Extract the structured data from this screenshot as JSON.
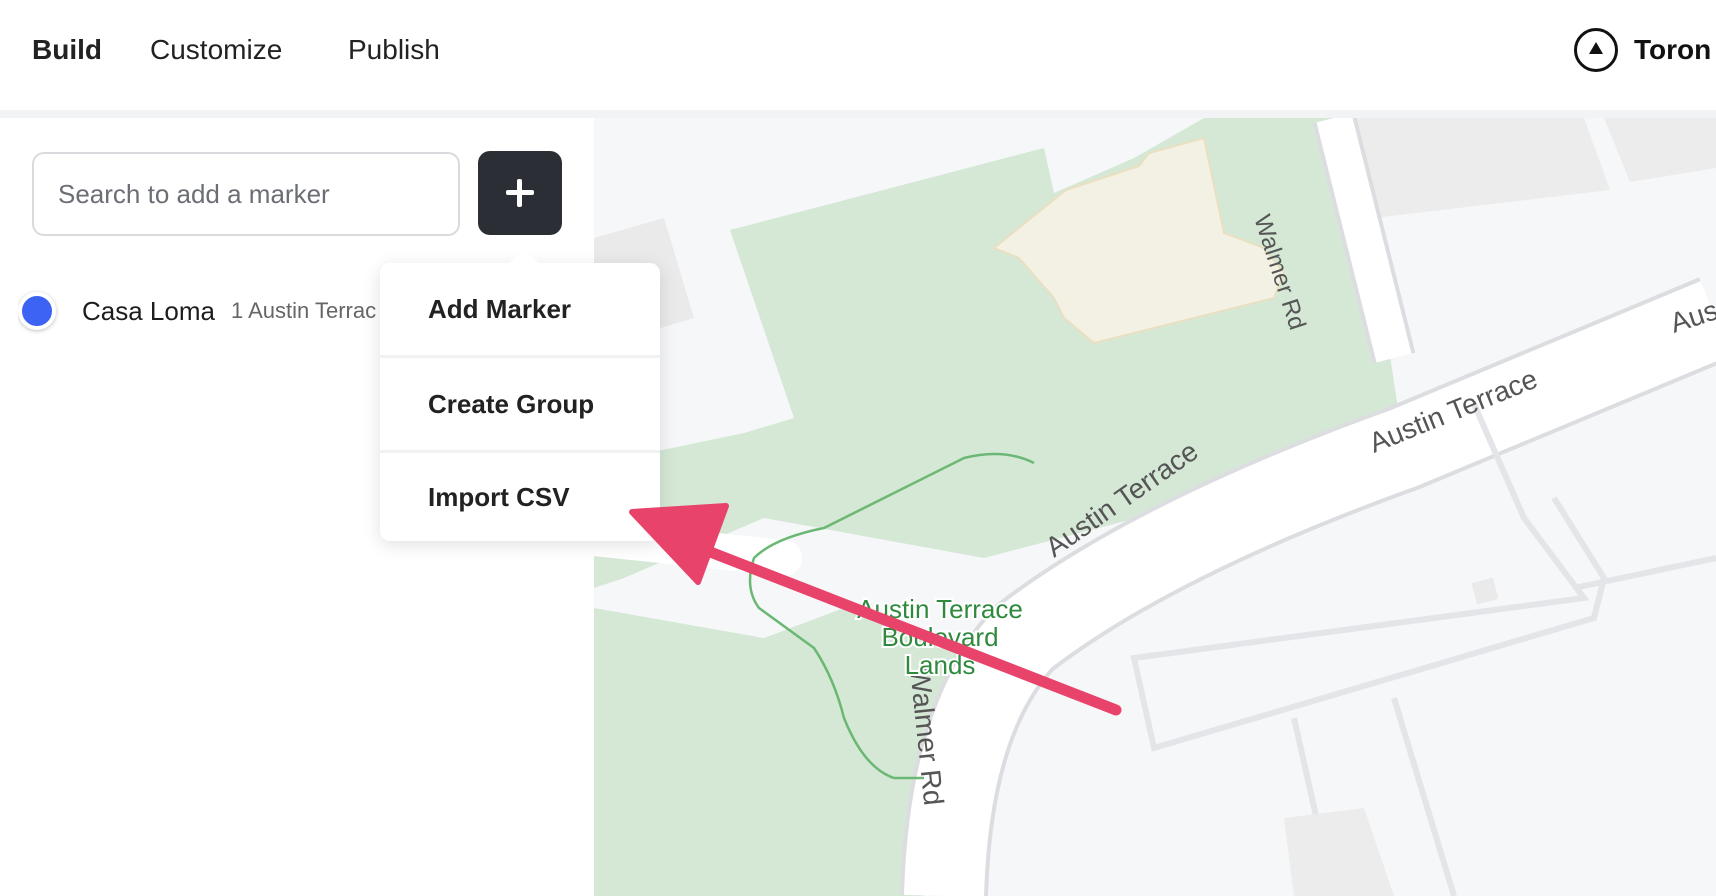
{
  "nav": {
    "tabs": [
      {
        "label": "Build",
        "active": true
      },
      {
        "label": "Customize",
        "active": false
      },
      {
        "label": "Publish",
        "active": false
      }
    ],
    "brand_name": "Toron"
  },
  "sidebar": {
    "search": {
      "placeholder": "Search to add a marker",
      "value": ""
    },
    "add_button_icon": "plus-icon",
    "markers": [
      {
        "name": "Casa Loma",
        "address": "1 Austin Terrac",
        "color": "#3d63f5"
      }
    ]
  },
  "dropdown": {
    "items": [
      {
        "label": "Add Marker"
      },
      {
        "label": "Create Group"
      },
      {
        "label": "Import CSV"
      }
    ]
  },
  "map": {
    "labels": {
      "walmer_rd_top": "Walmer Rd",
      "walmer_rd_bottom": "Walmer Rd",
      "austin_terrace_1": "Austin Terrace",
      "austin_terrace_2": "Austin Terrace",
      "austin_terrace_3": "Aus",
      "park_line1": "Austin Terrace",
      "park_line2": "Boulevard",
      "park_line3": "Lands"
    },
    "colors": {
      "park": "#d5e8d6",
      "road": "#ffffff",
      "ground": "#f6f7f9",
      "building": "#eaeaea",
      "castle": "#f3f1e3",
      "path": "#6bb874",
      "park_text": "#2f8a3e"
    }
  },
  "annotation": {
    "color": "#e8436b"
  }
}
